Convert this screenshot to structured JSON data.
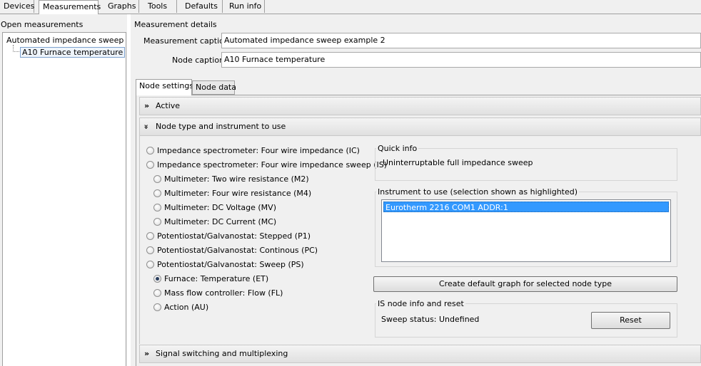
{
  "top_tabs": [
    "Devices",
    "Measurements",
    "Graphs",
    "Tools",
    "Defaults",
    "Run info"
  ],
  "left": {
    "title": "Open measurements",
    "tree": {
      "root": "Automated impedance sweep exar",
      "child": "A10 Furnace temperature"
    }
  },
  "details": {
    "title": "Measurement details",
    "measurement_caption_label": "Measurement caption",
    "measurement_caption_value": "Automated impedance sweep example 2",
    "node_caption_label": "Node caption",
    "node_caption_value": "A10 Furnace temperature"
  },
  "inner_tabs": [
    "Node settings",
    "Node data"
  ],
  "sections": {
    "active": "Active",
    "node_type": "Node type and instrument to use",
    "signal": "Signal switching and multiplexing"
  },
  "node_types": [
    "Impedance spectrometer: Four wire impedance (IC)",
    "Impedance spectrometer: Four wire impedance sweep (IS)",
    "Multimeter: Two wire resistance (M2)",
    "Multimeter: Four wire resistance (M4)",
    "Multimeter: DC Voltage (MV)",
    "Multimeter: DC Current (MC)",
    "Potentiostat/Galvanostat: Stepped (P1)",
    "Potentiostat/Galvanostat: Continous (PC)",
    "Potentiostat/Galvanostat: Sweep (PS)",
    "Furnace: Temperature (ET)",
    "Mass flow controller: Flow (FL)",
    "Action (AU)"
  ],
  "selected_node_type": "Furnace: Temperature (ET)",
  "quick_info": {
    "title": "Quick info",
    "text": "Uninterruptable full impedance sweep"
  },
  "instrument": {
    "title": "Instrument to use (selection shown as highlighted)",
    "selected": "Eurotherm 2216 COM1 ADDR:1"
  },
  "create_graph_button": "Create default graph for selected node type",
  "is_node": {
    "title": "IS node info and reset",
    "status": "Sweep status: Undefined",
    "reset_button": "Reset"
  },
  "chevrons": {
    "collapsed": "»",
    "expanded": "«"
  },
  "colors": {
    "selection": "#3399ff",
    "panel": "#f0f0f0"
  }
}
